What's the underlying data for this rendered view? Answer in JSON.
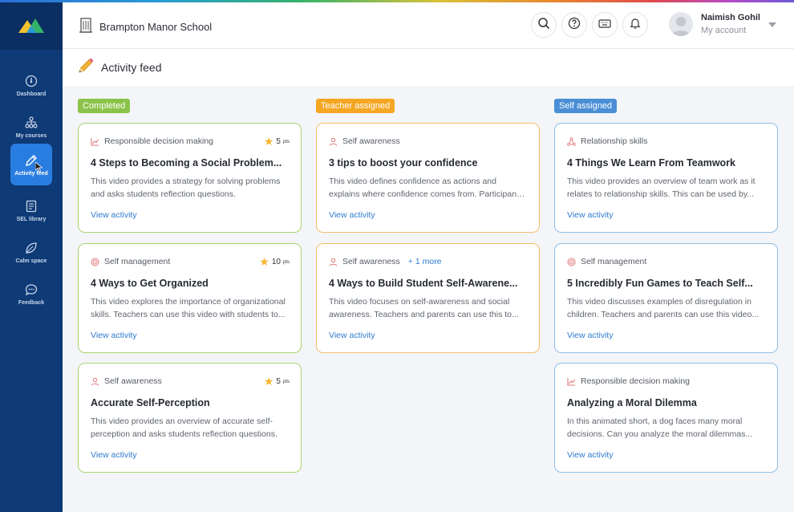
{
  "school": {
    "name": "Brampton Manor School"
  },
  "account": {
    "name": "Naimish Gohil",
    "subtitle": "My account"
  },
  "page": {
    "title": "Activity feed"
  },
  "nav": [
    {
      "label": "Dashboard",
      "icon": "dashboard-icon"
    },
    {
      "label": "My courses",
      "icon": "courses-icon"
    },
    {
      "label": "Activity feed",
      "icon": "pencil-icon",
      "active": true
    },
    {
      "label": "SEL library",
      "icon": "library-icon"
    },
    {
      "label": "Calm space",
      "icon": "leaf-icon"
    },
    {
      "label": "Feedback",
      "icon": "chat-icon"
    }
  ],
  "columns": [
    {
      "tag": "Completed",
      "color": "#8bc34a",
      "cards": [
        {
          "category": "Responsible decision making",
          "category_icon": "chart-icon",
          "points": "5",
          "points_unit": "pts",
          "title": "4 Steps to Becoming a Social Problem...",
          "description": "This video provides a strategy for solving problems and asks students reflection questions.",
          "link": "View activity"
        },
        {
          "category": "Self management",
          "category_icon": "target-icon",
          "points": "10",
          "points_unit": "pts",
          "title": "4 Ways to Get Organized",
          "description": "This video explores the importance of organizational skills. Teachers can use this video with students to...",
          "link": "View activity"
        },
        {
          "category": "Self awareness",
          "category_icon": "person-icon",
          "points": "5",
          "points_unit": "pts",
          "title": "Accurate Self-Perception",
          "description": "This video provides an overview of accurate self-perception and asks students reflection questions.",
          "link": "View activity"
        }
      ]
    },
    {
      "tag": "Teacher assigned",
      "color": "#f5a623",
      "cards": [
        {
          "category": "Self awareness",
          "category_icon": "person-icon",
          "title": "3 tips to boost your confidence",
          "description": "This video defines confidence as actions and explains where confidence comes from. Participants will also...",
          "link": "View activity"
        },
        {
          "category": "Self awareness",
          "category_icon": "person-icon",
          "more": "+ 1 more",
          "title": "4 Ways to Build Student Self-Awarene...",
          "description": "This video focuses on self-awareness and social awareness. Teachers and parents can use this to...",
          "link": "View activity"
        }
      ]
    },
    {
      "tag": "Self assigned",
      "color": "#4a8fd6",
      "cards": [
        {
          "category": "Relationship skills",
          "category_icon": "network-icon",
          "title": "4 Things We Learn From Teamwork",
          "description": "This video provides an overview of team work as it relates to relationship skills. This can be used by...",
          "link": "View activity"
        },
        {
          "category": "Self management",
          "category_icon": "target-icon",
          "title": "5 Incredibly Fun Games to Teach Self...",
          "description": "This video discusses examples of disregulation in children. Teachers and parents can use this video...",
          "link": "View activity"
        },
        {
          "category": "Responsible decision making",
          "category_icon": "chart-icon",
          "title": "Analyzing a Moral Dilemma",
          "description": "In this animated short, a dog faces many moral decisions. Can you analyze the moral dilemmas...",
          "link": "View activity"
        }
      ]
    }
  ]
}
